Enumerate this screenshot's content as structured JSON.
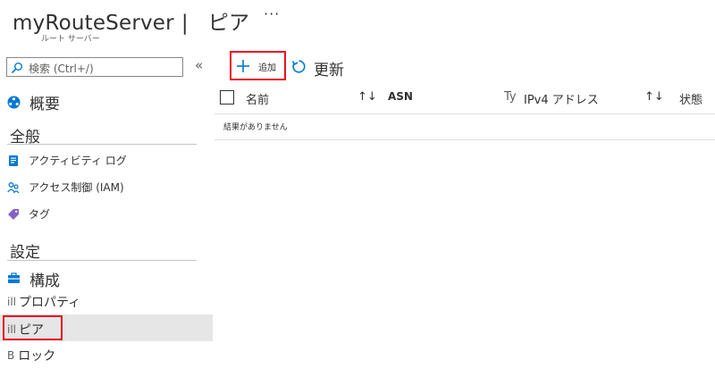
{
  "header": {
    "resource_name": "myRouteServer",
    "separator": "|",
    "page_title": "ピア",
    "subtitle": "ルート サーバー",
    "more": "···"
  },
  "sidebar": {
    "search_placeholder": "検索 (Ctrl+/)",
    "collapse": "«",
    "overview": "概要",
    "general_heading": "全般",
    "general_items": [
      {
        "label": "アクティビティ ログ",
        "icon": "activity-log-icon"
      },
      {
        "label": "アクセス制御 (IAM)",
        "icon": "iam-icon"
      },
      {
        "label": "タグ",
        "icon": "tag-icon"
      }
    ],
    "settings_heading": "設定",
    "settings_items": [
      {
        "label": "構成",
        "icon": "configuration-icon"
      },
      {
        "label": "プロパティ",
        "icon": "properties-icon",
        "prefix": "ill"
      },
      {
        "label": "ピア",
        "icon": "peers-icon",
        "prefix": "ill",
        "selected": true
      },
      {
        "label": "ロック",
        "icon": "lock-icon",
        "prefix": "B"
      }
    ]
  },
  "toolbar": {
    "add_label": "追加",
    "refresh_label": "更新"
  },
  "table": {
    "columns": [
      "名前",
      "ASN",
      "IPv4 アドレス",
      "状態"
    ],
    "column_prefix": "Ty",
    "sort_glyph": "↑↓",
    "empty_message": "結果がありません"
  },
  "colors": {
    "highlight": "#e81123",
    "accent": "#0078d4",
    "selected_bg": "#e6e6e6"
  }
}
